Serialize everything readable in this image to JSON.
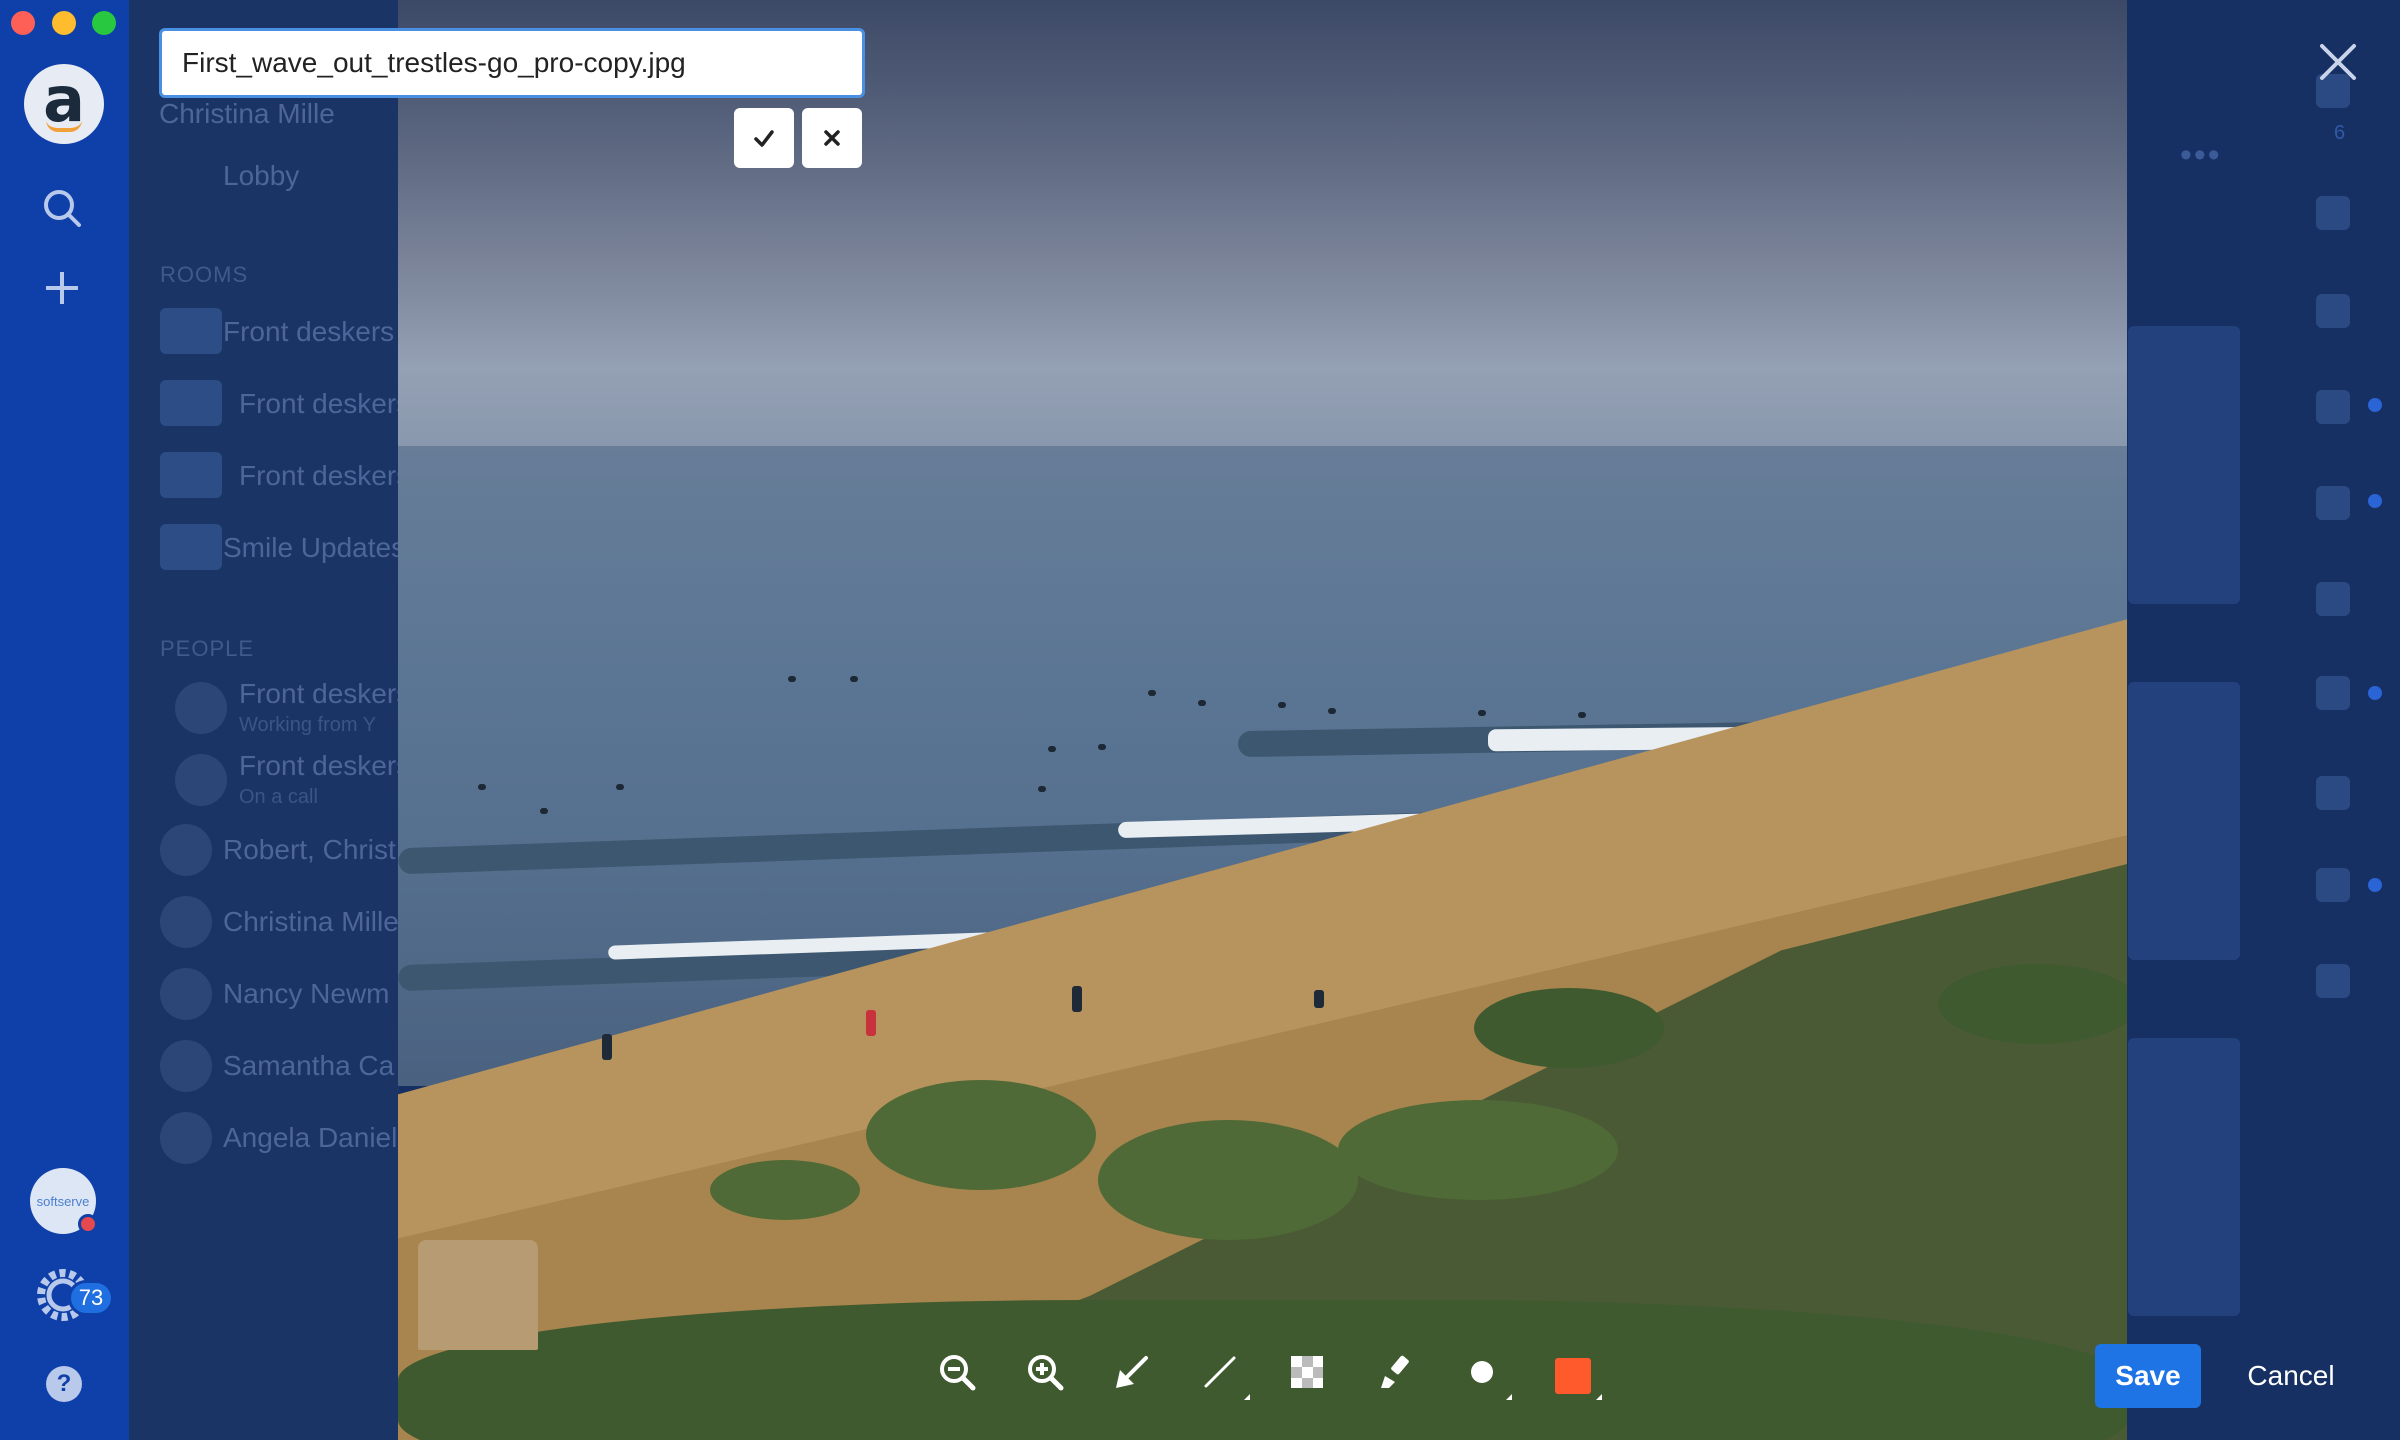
{
  "editor": {
    "filename": "First_wave_out_trestles-go_pro-copy.jpg",
    "save_label": "Save",
    "cancel_label": "Cancel",
    "color_swatch": "#ff5a2c"
  },
  "rail": {
    "notification_count": "73",
    "org_avatar_text": "softserve"
  },
  "background": {
    "items": [
      "Lobby",
      "ROOMS",
      "Front deskers",
      "Front deskers",
      "Front deskers",
      "Smile Updates",
      "PEOPLE",
      "Front deskers",
      "Working from Y",
      "Front deskers",
      "On a call",
      "Robert, Christ",
      "Christina Mille",
      "Nancy Newm",
      "Samantha Ca",
      "Angela Daniel"
    ],
    "member_count": "6"
  }
}
